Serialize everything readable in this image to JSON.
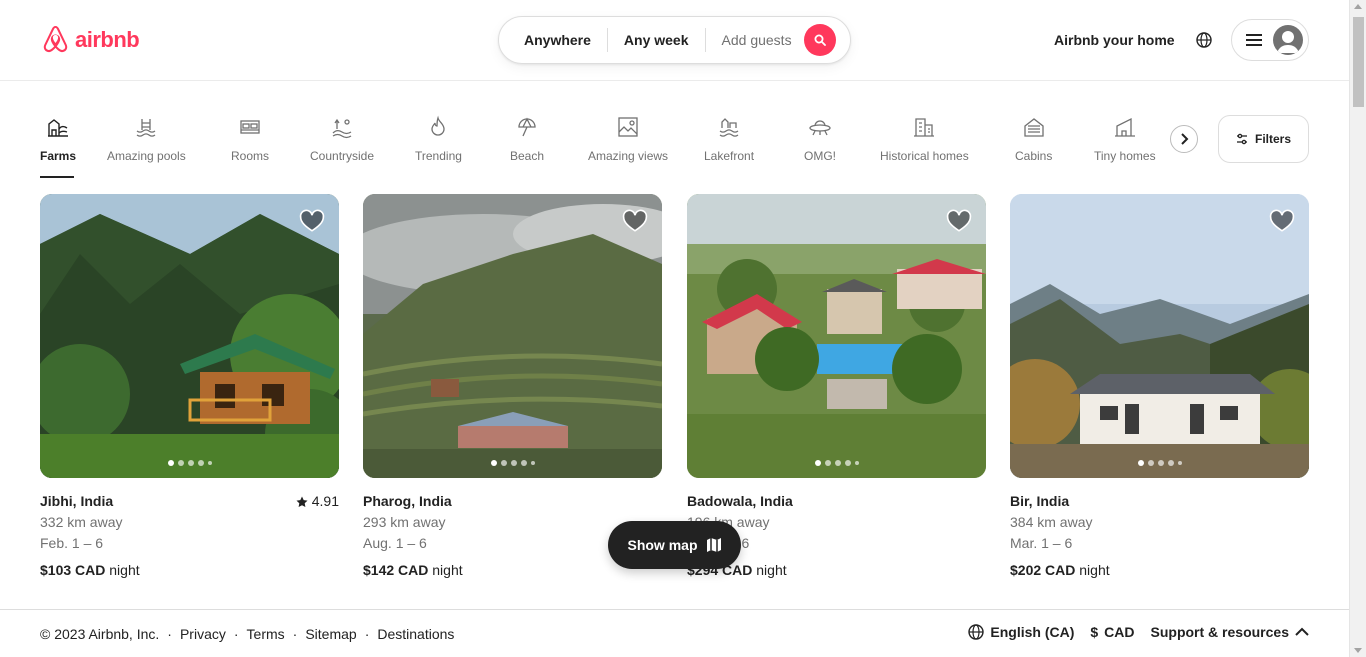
{
  "brand": {
    "name": "airbnb",
    "color": "#FF385C"
  },
  "search": {
    "where": "Anywhere",
    "when": "Any week",
    "guests": "Add guests"
  },
  "header": {
    "host_link": "Airbnb your home"
  },
  "categories": [
    {
      "label": "Farms",
      "icon": "farm-icon",
      "active": true
    },
    {
      "label": "Amazing pools",
      "icon": "pool-icon"
    },
    {
      "label": "Rooms",
      "icon": "bed-icon"
    },
    {
      "label": "Countryside",
      "icon": "countryside-icon"
    },
    {
      "label": "Trending",
      "icon": "flame-icon"
    },
    {
      "label": "Beach",
      "icon": "umbrella-icon"
    },
    {
      "label": "Amazing views",
      "icon": "view-icon"
    },
    {
      "label": "Lakefront",
      "icon": "lake-icon"
    },
    {
      "label": "OMG!",
      "icon": "ufo-icon"
    },
    {
      "label": "Historical homes",
      "icon": "historic-building-icon"
    },
    {
      "label": "Cabins",
      "icon": "cabin-icon"
    },
    {
      "label": "Tiny homes",
      "icon": "tiny-home-icon"
    }
  ],
  "filters_label": "Filters",
  "listings": [
    {
      "location": "Jibhi, India",
      "rating": "4.91",
      "distance": "332 km away",
      "dates": "Feb. 1 – 6",
      "price": "$103 CAD",
      "price_unit": "night"
    },
    {
      "location": "Pharog, India",
      "rating": "",
      "distance": "293 km away",
      "dates": "Aug. 1 – 6",
      "price": "$142 CAD",
      "price_unit": "night"
    },
    {
      "location": "Badowala, India",
      "rating": "",
      "distance": "196 km away",
      "dates": "Mar. 1 – 6",
      "price": "$294 CAD",
      "price_unit": "night"
    },
    {
      "location": "Bir, India",
      "rating": "",
      "distance": "384 km away",
      "dates": "Mar. 1 – 6",
      "price": "$202 CAD",
      "price_unit": "night"
    }
  ],
  "show_map": "Show map",
  "footer": {
    "copyright": "© 2023 Airbnb, Inc.",
    "links": [
      "Privacy",
      "Terms",
      "Sitemap",
      "Destinations"
    ],
    "language": "English (CA)",
    "currency_symbol": "$",
    "currency": "CAD",
    "support": "Support & resources"
  }
}
